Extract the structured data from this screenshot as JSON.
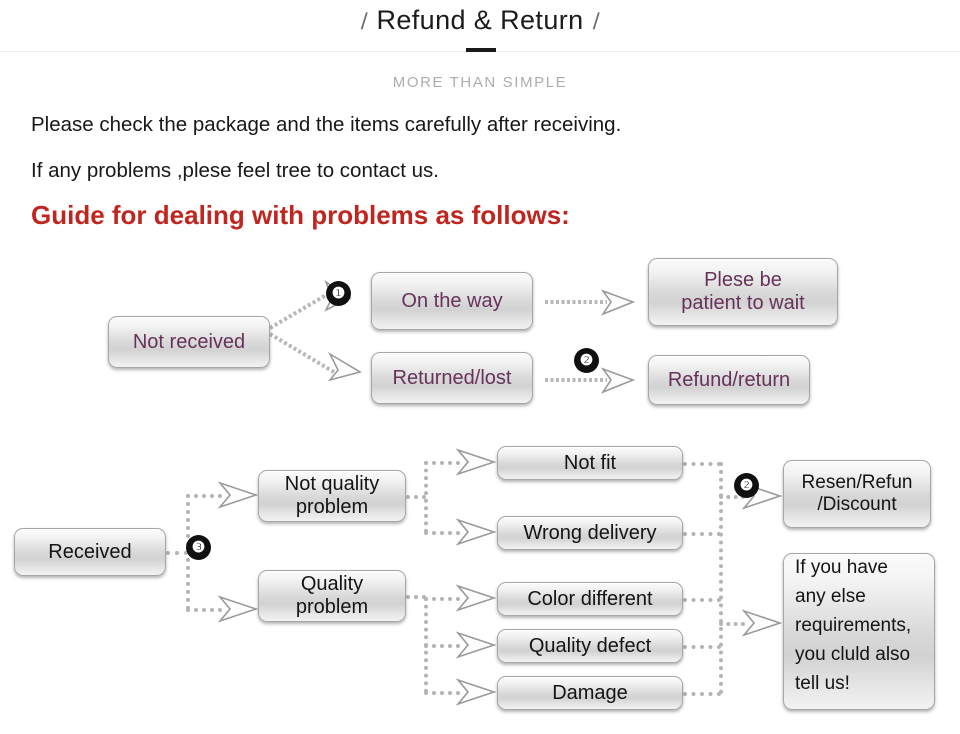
{
  "header": {
    "title": "Refund & Return",
    "slash_left": "/",
    "slash_right": "/",
    "subtitle": "MORE THAN SIMPLE"
  },
  "intro": {
    "line1": "Please check the package and the items carefully after receiving.",
    "line2": "If any problems ,plese feel tree to contact us.",
    "guide_heading": "Guide for dealing with problems as follows:"
  },
  "colors": {
    "heading_red": "#c0261f",
    "box_text_purple": "#66325a",
    "box_text_black": "#141414",
    "subtitle_gray": "#adadad",
    "connector_gray": "#b4b4b4",
    "badge_black": "#101010"
  },
  "flow_not_received": {
    "source": "Not received",
    "branches": [
      {
        "cause": "On the way",
        "badge": "❶",
        "result": "Plese be\npatient to wait",
        "result_line1": "Plese be",
        "result_line2": "patient to wait"
      },
      {
        "cause": "Returned/lost",
        "badge": "❷",
        "result": "Refund/return"
      }
    ]
  },
  "flow_received": {
    "source": "Received",
    "badge": "❸",
    "groups": [
      {
        "label": "Not quality problem",
        "label_line1": "Not quality",
        "label_line2": "problem",
        "items": [
          "Not fit",
          "Wrong delivery"
        ]
      },
      {
        "label": "Quality problem",
        "label_line1": "Quality",
        "label_line2": "problem",
        "items": [
          "Color different",
          "Quality defect",
          "Damage"
        ]
      }
    ],
    "outcomes": [
      {
        "badge": "❷",
        "text": "Resen/Refun /Discount",
        "line1": "Resen/Refun",
        "line2": "/Discount"
      },
      {
        "text": "If you have any else requirements, you cluld also tell us!",
        "line1": "If you have",
        "line2": "any else",
        "line3": "requirements,",
        "line4": "you cluld also",
        "line5": "tell us!"
      }
    ]
  }
}
